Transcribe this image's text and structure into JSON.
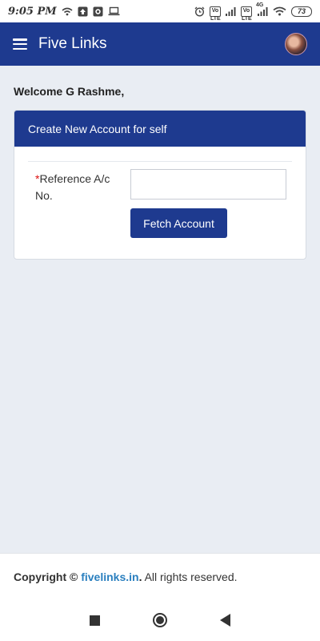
{
  "status_bar": {
    "time": "9:05 PM",
    "left_icons": [
      "wifi-icon",
      "upload-icon",
      "app-icon",
      "laptop-icon"
    ],
    "right_icons": [
      "alarm-icon",
      "volte-icon",
      "signal-icon",
      "volte-icon",
      "4g-signal-icon",
      "wifi-icon"
    ],
    "volte_label": "Vo LTE",
    "network_label": "4G",
    "battery": "73"
  },
  "app_bar": {
    "menu_icon": "hamburger-menu-icon",
    "title": "Five Links",
    "avatar_icon": "user-avatar"
  },
  "welcome": "Welcome G Rashme,",
  "card": {
    "header": "Create New Account for self",
    "field": {
      "required_mark": "*",
      "label": "Reference A/c No.",
      "value": "",
      "placeholder": ""
    },
    "button_label": "Fetch Account"
  },
  "footer": {
    "prefix": "Copyright ©",
    "brand": "fivelinks.in",
    "suffix": ". All rights reserved."
  },
  "nav_bar": {
    "icons": [
      "recent-apps-icon",
      "home-icon",
      "back-icon"
    ]
  },
  "colors": {
    "primary": "#1e3a8f",
    "background": "#e9edf3",
    "link": "#2a7fbf",
    "required": "#dd1111"
  }
}
